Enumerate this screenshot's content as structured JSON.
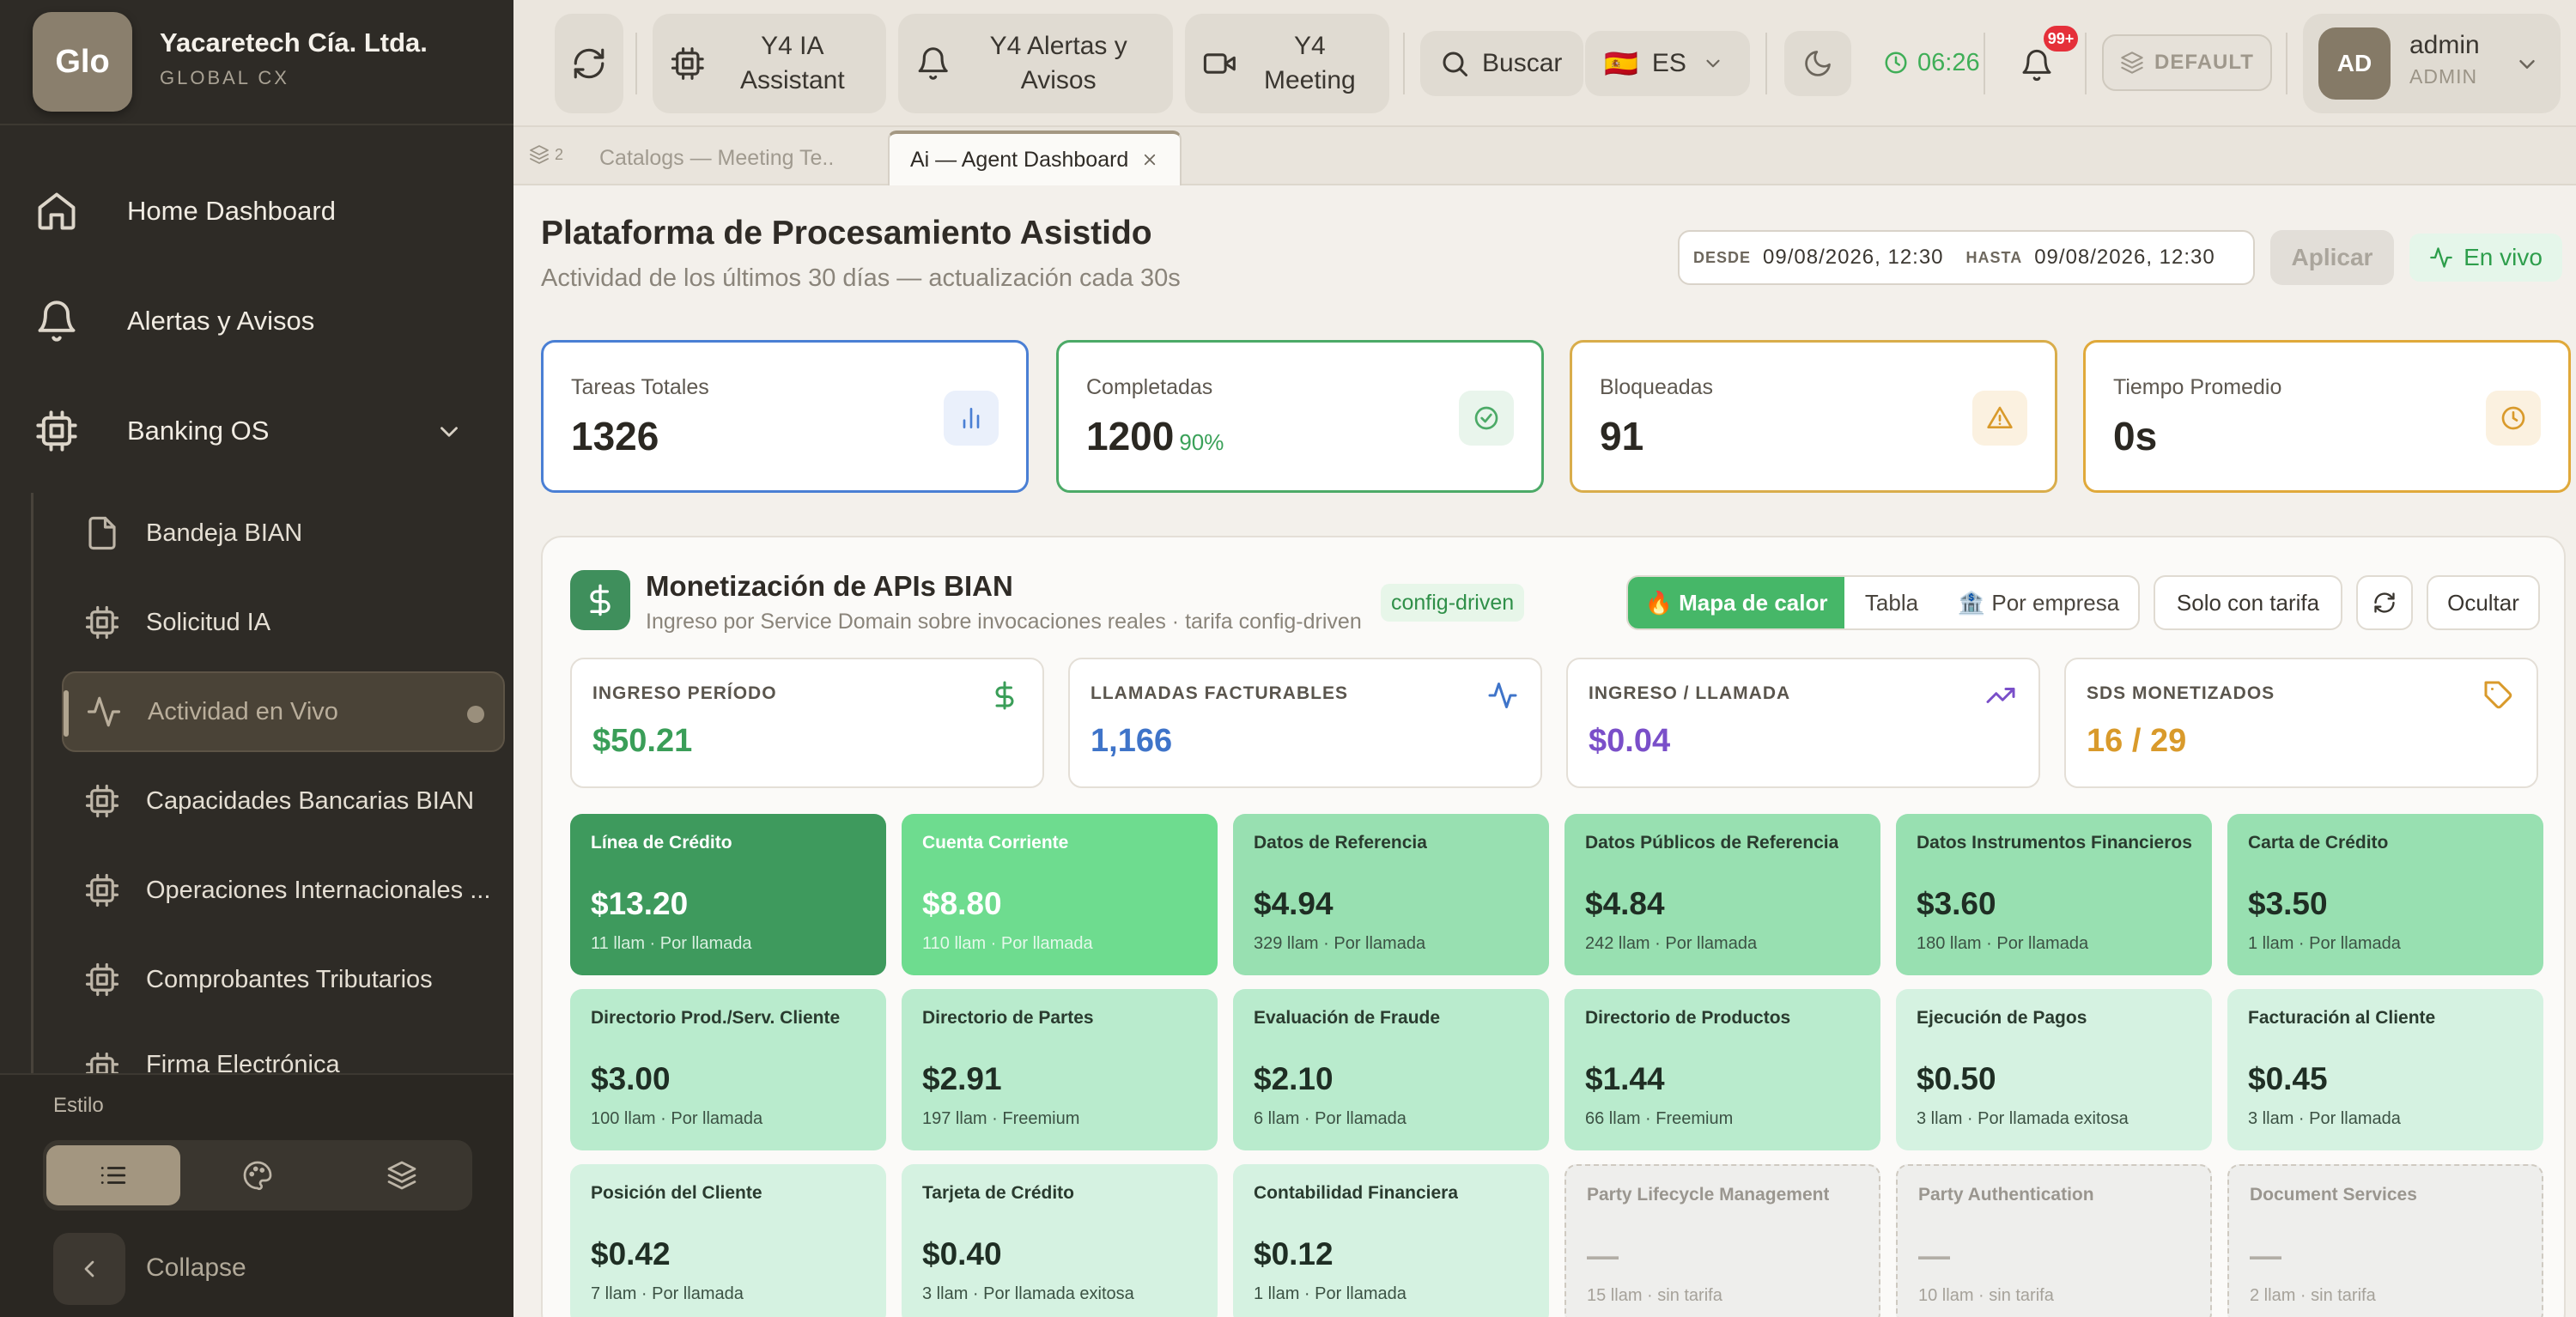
{
  "brand": {
    "logo": "Glo",
    "name": "Yacaretech Cía. Ltda.",
    "subtitle": "GLOBAL CX"
  },
  "sidebar": {
    "items": [
      {
        "label": "Home Dashboard",
        "icon": "home-icon"
      },
      {
        "label": "Alertas y Avisos",
        "icon": "bell-icon"
      },
      {
        "label": "Banking OS",
        "icon": "cpu-icon",
        "expanded": true
      }
    ],
    "subitems": [
      {
        "label": "Bandeja BIAN",
        "icon": "file-icon"
      },
      {
        "label": "Solicitud IA",
        "icon": "cpu-icon"
      },
      {
        "label": "Actividad en Vivo",
        "icon": "activity-icon",
        "active": true
      },
      {
        "label": "Capacidades Bancarias BIAN",
        "icon": "cpu-icon"
      },
      {
        "label": "Operaciones Internacionales ...",
        "icon": "cpu-icon"
      },
      {
        "label": "Comprobantes Tributarios",
        "icon": "cpu-icon"
      },
      {
        "label": "Firma Electrónica",
        "icon": "cpu-icon"
      }
    ],
    "style_label": "Estilo",
    "collapse_label": "Collapse"
  },
  "header": {
    "buttons": [
      {
        "label": "Y4 IA Assistant",
        "icon": "cpu-icon"
      },
      {
        "label": "Y4 Alertas y Avisos",
        "icon": "bell-icon"
      },
      {
        "label": "Y4 Meeting",
        "icon": "video-icon"
      }
    ],
    "search_label": "Buscar",
    "lang": "ES",
    "flag": "🇪🇸",
    "time": "06:26",
    "badge": "99+",
    "default_label": "DEFAULT",
    "user": {
      "initials": "AD",
      "name": "admin",
      "role": "ADMIN"
    }
  },
  "tabs": {
    "count": "2",
    "inactive": "Catalogs — Meeting Te..",
    "active": "Ai — Agent Dashboard"
  },
  "page": {
    "title": "Plataforma de Procesamiento Asistido",
    "subtitle": "Actividad de los últimos 30 días — actualización cada 30s",
    "from_label": "DESDE",
    "from_value": "09/08/2026, 12:30",
    "to_label": "HASTA",
    "to_value": "09/08/2026, 12:30",
    "apply_label": "Aplicar",
    "live_label": "En vivo"
  },
  "stats": [
    {
      "label": "Tareas Totales",
      "value": "1326",
      "pct": "",
      "color": "#4a7fd4",
      "icon": "bar-chart-icon"
    },
    {
      "label": "Completadas",
      "value": "1200",
      "pct": "90%",
      "color": "#4caa67",
      "icon": "check-circle-icon"
    },
    {
      "label": "Bloqueadas",
      "value": "91",
      "pct": "",
      "color": "#d9ad4b",
      "icon": "warning-icon"
    },
    {
      "label": "Tiempo Promedio",
      "value": "0s",
      "pct": "",
      "color": "#e0a93a",
      "icon": "clock-icon"
    }
  ],
  "panel": {
    "title": "Monetización de APIs BIAN",
    "subtitle": "Ingreso por Service Domain sobre invocaciones reales · tarifa config-driven",
    "tag": "config-driven",
    "views": [
      "🔥 Mapa de calor",
      "Tabla",
      "🏦 Por empresa"
    ],
    "active_view": "🔥 Mapa de calor",
    "filter_label": "Solo con tarifa",
    "hide_label": "Ocultar",
    "kpis": [
      {
        "label": "INGRESO PERÍODO",
        "value": "$50.21",
        "color": "#3a9e58",
        "icon": "dollar-icon"
      },
      {
        "label": "LLAMADAS FACTURABLES",
        "value": "1,166",
        "color": "#3f74c9",
        "icon": "activity-icon"
      },
      {
        "label": "INGRESO / LLAMADA",
        "value": "$0.04",
        "color": "#7a4fc9",
        "icon": "trending-up-icon"
      },
      {
        "label": "SDS MONETIZADOS",
        "value": "16 / 29",
        "color": "#d99a2b",
        "icon": "tag-icon"
      }
    ],
    "cells": [
      {
        "name": "Línea de Crédito",
        "value": "$13.20",
        "meta": "11 llam · Por llamada",
        "level": 5
      },
      {
        "name": "Cuenta Corriente",
        "value": "$8.80",
        "meta": "110 llam · Por llamada",
        "level": 4
      },
      {
        "name": "Datos de Referencia",
        "value": "$4.94",
        "meta": "329 llam · Por llamada",
        "level": 3
      },
      {
        "name": "Datos Públicos de Referencia",
        "value": "$4.84",
        "meta": "242 llam · Por llamada",
        "level": 3
      },
      {
        "name": "Datos Instrumentos Financieros",
        "value": "$3.60",
        "meta": "180 llam · Por llamada",
        "level": 3
      },
      {
        "name": "Carta de Crédito",
        "value": "$3.50",
        "meta": "1 llam · Por llamada",
        "level": 3
      },
      {
        "name": "Directorio Prod./Serv. Cliente",
        "value": "$3.00",
        "meta": "100 llam · Por llamada",
        "level": 2
      },
      {
        "name": "Directorio de Partes",
        "value": "$2.91",
        "meta": "197 llam · Freemium",
        "level": 2
      },
      {
        "name": "Evaluación de Fraude",
        "value": "$2.10",
        "meta": "6 llam · Por llamada",
        "level": 2
      },
      {
        "name": "Directorio de Productos",
        "value": "$1.44",
        "meta": "66 llam · Freemium",
        "level": 2
      },
      {
        "name": "Ejecución de Pagos",
        "value": "$0.50",
        "meta": "3 llam · Por llamada exitosa",
        "level": 1
      },
      {
        "name": "Facturación al Cliente",
        "value": "$0.45",
        "meta": "3 llam · Por llamada",
        "level": 1
      },
      {
        "name": "Posición del Cliente",
        "value": "$0.42",
        "meta": "7 llam · Por llamada",
        "level": 1
      },
      {
        "name": "Tarjeta de Crédito",
        "value": "$0.40",
        "meta": "3 llam · Por llamada exitosa",
        "level": 1
      },
      {
        "name": "Contabilidad Financiera",
        "value": "$0.12",
        "meta": "1 llam · Por llamada",
        "level": 1
      },
      {
        "name": "Party Lifecycle Management",
        "value": "—",
        "meta": "15 llam · sin tarifa",
        "level": 0
      },
      {
        "name": "Party Authentication",
        "value": "—",
        "meta": "10 llam · sin tarifa",
        "level": 0
      },
      {
        "name": "Document Services",
        "value": "—",
        "meta": "2 llam · sin tarifa",
        "level": 0
      }
    ]
  }
}
